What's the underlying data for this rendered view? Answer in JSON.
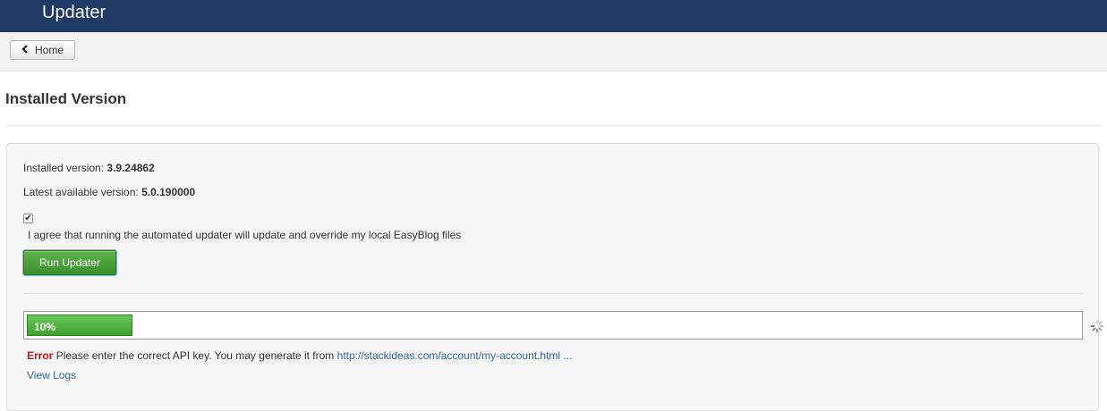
{
  "header": {
    "title": "Updater"
  },
  "toolbar": {
    "home_label": "Home"
  },
  "section": {
    "title": "Installed Version"
  },
  "versions": {
    "installed_label": "Installed version:",
    "installed_value": "3.9.24862",
    "latest_label": "Latest available version:",
    "latest_value": "5.0.190000"
  },
  "agree": {
    "checked": true,
    "text": "I agree that running the automated updater will update and override my local EasyBlog files"
  },
  "run_button": {
    "label": "Run Updater"
  },
  "progress": {
    "percent": 10,
    "label": "10%"
  },
  "message": {
    "error_word": "Error",
    "text": "Please enter the correct API key. You may generate it from",
    "link_text": "http://stackideas.com/account/my-account.html ..."
  },
  "view_logs": "View Logs",
  "colors": {
    "header_bg": "#1f3a66",
    "run_button_bg": "#4a9e38",
    "progress_fill": "#52b343",
    "error": "#cc1111",
    "link": "#336699"
  },
  "icons": {
    "back": "chevron-left-icon",
    "loading": "spinner-icon"
  }
}
